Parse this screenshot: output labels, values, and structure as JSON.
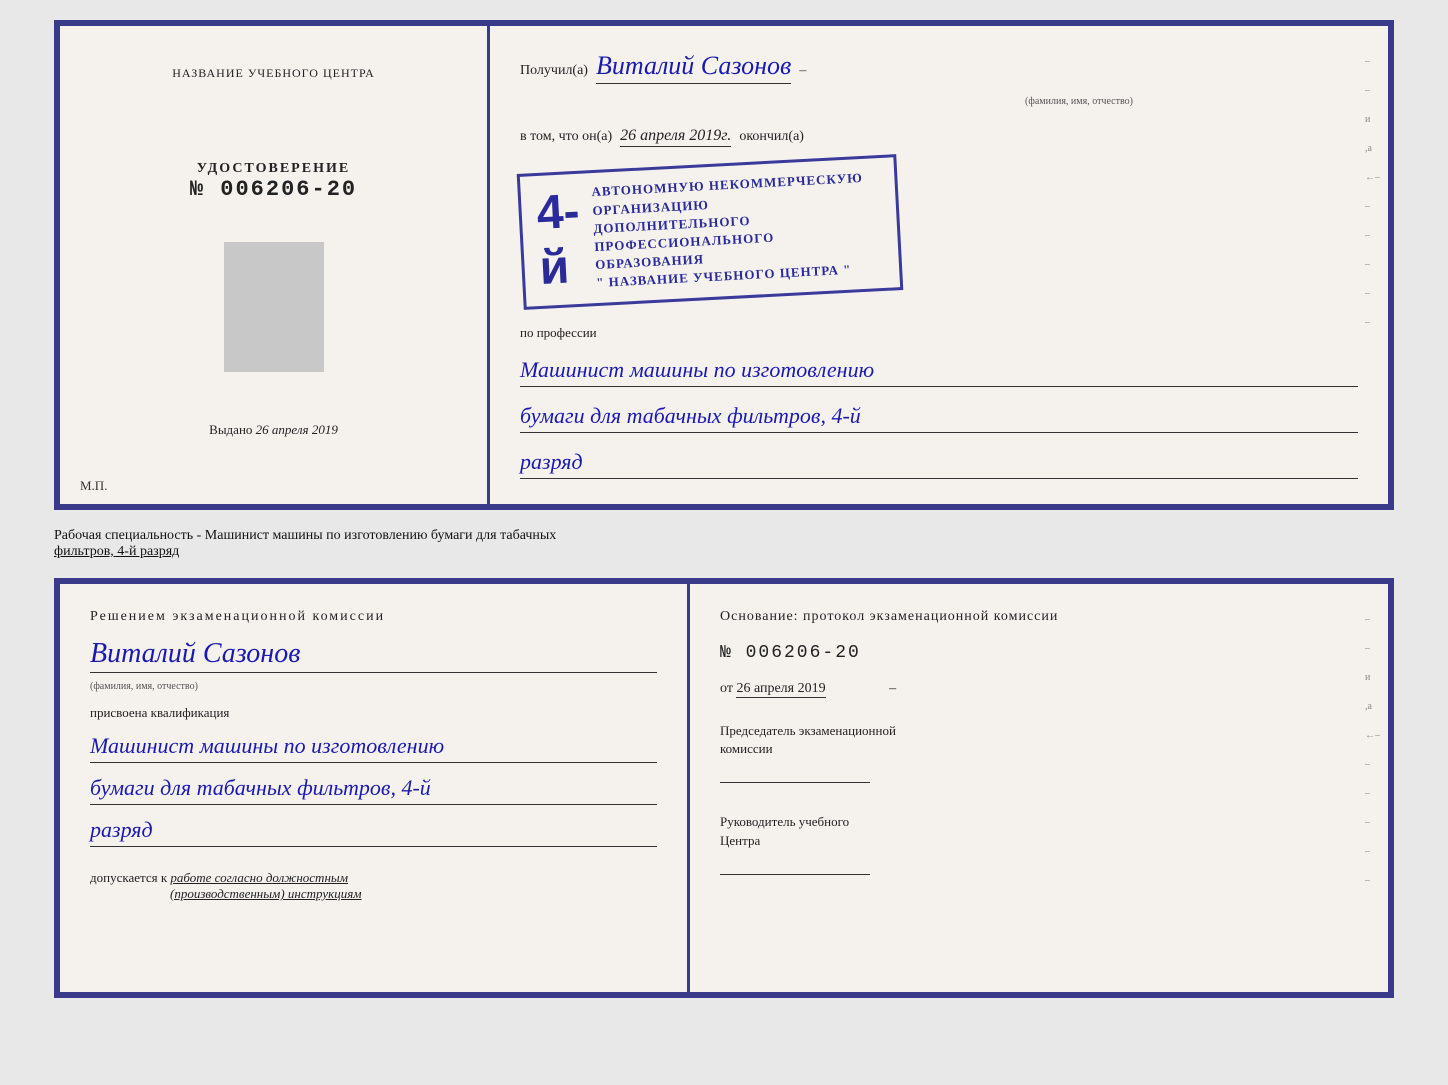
{
  "top_cert": {
    "left": {
      "training_center_label": "НАЗВАНИЕ УЧЕБНОГО ЦЕНТРА",
      "udostoverenie_title": "УДОСТОВЕРЕНИЕ",
      "udostoverenie_number": "№ 006206-20",
      "vydano_prefix": "Выдано",
      "vydano_date": "26 апреля 2019",
      "mp_label": "М.П."
    },
    "right": {
      "poluchil_prefix": "Получил(а)",
      "poluchil_name": "Виталий Сазонов",
      "fio_label": "(фамилия, имя, отчество)",
      "vtom_prefix": "в том, что он(а)",
      "vtom_date": "26 апреля 2019г.",
      "okonchil": "окончил(а)",
      "stamp_number": "4-й",
      "stamp_line1": "АВТОНОМНУЮ НЕКОММЕРЧЕСКУЮ ОРГАНИЗАЦИЮ",
      "stamp_line2": "ДОПОЛНИТЕЛЬНОГО ПРОФЕССИОНАЛЬНОГО ОБРАЗОВАНИЯ",
      "stamp_line3": "\" НАЗВАНИЕ УЧЕБНОГО ЦЕНТРА \"",
      "po_professii": "по профессии",
      "profession_line1": "Машинист машины по изготовлению",
      "profession_line2": "бумаги для табачных фильтров, 4-й",
      "profession_line3": "разряд"
    }
  },
  "between_text": "Рабочая специальность - Машинист машины по изготовлению бумаги для табачных",
  "between_text2": "фильтров, 4-й разряд",
  "bottom_cert": {
    "left": {
      "resheniem": "Решением  экзаменационной  комиссии",
      "person_name": "Виталий Сазонов",
      "fio_label": "(фамилия, имя, отчество)",
      "prisvoena": "присвоена квалификация",
      "qual_line1": "Машинист машины по изготовлению",
      "qual_line2": "бумаги для табачных фильтров, 4-й",
      "qual_line3": "разряд",
      "dopuskaetsya_prefix": "допускается к",
      "dopuskaetsya_value": "работе согласно должностным",
      "dopuskaetsya_value2": "(производственным) инструкциям"
    },
    "right": {
      "osnovanie": "Основание:  протокол  экзаменационной  комиссии",
      "number_label": "№  006206-20",
      "ot_prefix": "от",
      "ot_date": "26 апреля 2019",
      "predsedatel_label": "Председатель экзаменационной",
      "predsedatel_label2": "комиссии",
      "rukovoditel_label": "Руководитель учебного",
      "rukovoditel_label2": "Центра"
    }
  }
}
